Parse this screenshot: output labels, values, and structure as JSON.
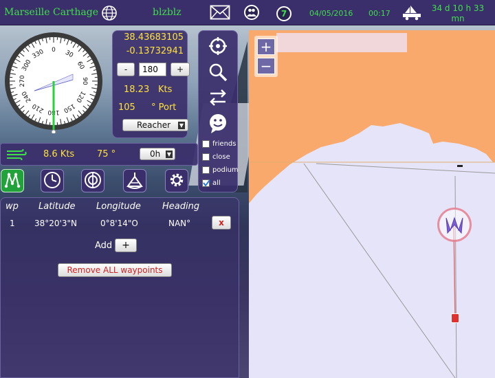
{
  "topbar": {
    "boat_name": "Marseille Carthage",
    "player": "blzblz",
    "badge": "7",
    "date": "04/05/2016",
    "time": "00:17",
    "race_time": "34 d 10 h 33 mn",
    "icons": [
      "globe-icon",
      "mail-icon",
      "contacts-icon",
      "ranking-icon",
      "boat-truck-icon"
    ]
  },
  "boat": {
    "lat": "38.43683105",
    "lon": "-0.13732941",
    "heading_value": "180",
    "speed": "18.23",
    "speed_unit": "Kts",
    "wind_angle": "105",
    "wind_side": "° Port",
    "sail": "Reacher"
  },
  "wind": {
    "speed": "8.6 Kts",
    "direction": "75 °",
    "forecast": "0h"
  },
  "compass": {
    "labels": [
      "30",
      "60",
      "90",
      "120",
      "150",
      "180",
      "210",
      "240",
      "270",
      "300",
      "330",
      "0"
    ]
  },
  "tools": {
    "icons": [
      "target-icon",
      "zoom-icon",
      "swap-icon",
      "smiley-icon"
    ],
    "filters": [
      {
        "label": "friends",
        "checked": false
      },
      {
        "label": "close",
        "checked": false
      },
      {
        "label": "podium",
        "checked": false
      },
      {
        "label": "all",
        "checked": true
      }
    ]
  },
  "nav": {
    "icons": [
      "waypoints-icon",
      "clock-icon",
      "autopilot-icon",
      "sextant-icon",
      "settings-icon"
    ]
  },
  "waypoints": {
    "headers": [
      "wp",
      "Latitude",
      "Longitude",
      "Heading"
    ],
    "rows": [
      {
        "wp": "1",
        "lat": "38°20'3\"N",
        "lon": "0°8'14\"O",
        "heading": "NAN°",
        "delete": "x"
      }
    ],
    "add_label": "Add",
    "add_button": "+",
    "remove_all": "Remove ALL waypoints"
  },
  "map": {
    "zoom_in": "+",
    "zoom_out": "−",
    "colors": {
      "land": "#f9a96b",
      "sea": "#e6e4f8",
      "route": "#e07070"
    }
  },
  "heading_minus": "-",
  "heading_plus": "+"
}
